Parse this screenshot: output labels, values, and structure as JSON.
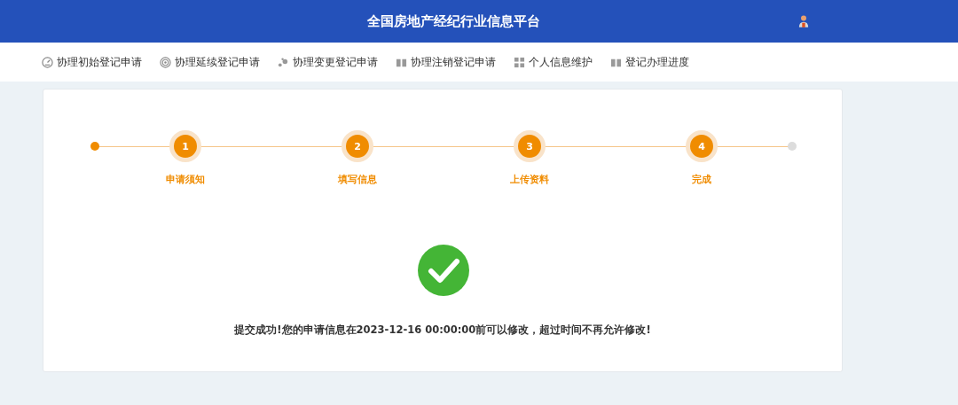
{
  "header": {
    "title": "全国房地产经纪行业信息平台"
  },
  "nav": [
    {
      "label": "协理初始登记申请"
    },
    {
      "label": "协理延续登记申请"
    },
    {
      "label": "协理变更登记申请"
    },
    {
      "label": "协理注销登记申请"
    },
    {
      "label": "个人信息维护"
    },
    {
      "label": "登记办理进度"
    }
  ],
  "steps": [
    {
      "number": "1",
      "label": "申请须知",
      "done": true
    },
    {
      "number": "2",
      "label": "填写信息",
      "done": true
    },
    {
      "number": "3",
      "label": "上传资料",
      "done": true
    },
    {
      "number": "4",
      "label": "完成",
      "done": true
    }
  ],
  "result": {
    "message": "提交成功!您的申请信息在2023-12-16 00:00:00前可以修改，超过时间不再允许修改!"
  }
}
